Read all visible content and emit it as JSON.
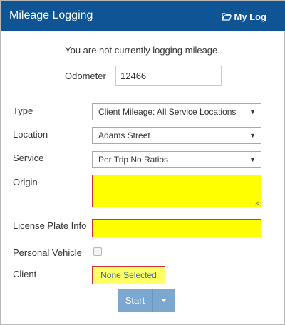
{
  "header": {
    "title": "Mileage Logging",
    "my_log_label": "My Log"
  },
  "status_text": "You are not currently logging mileage.",
  "odometer": {
    "label": "Odometer",
    "value": "12466"
  },
  "type": {
    "label": "Type",
    "value": "Client Mileage: All Service Locations"
  },
  "location": {
    "label": "Location",
    "value": "Adams Street"
  },
  "service": {
    "label": "Service",
    "value": "Per Trip No Ratios"
  },
  "origin": {
    "label": "Origin",
    "value": ""
  },
  "license_plate": {
    "label": "License Plate Info",
    "value": ""
  },
  "personal_vehicle": {
    "label": "Personal Vehicle",
    "checked": false
  },
  "client": {
    "label": "Client",
    "button_label": "None Selected"
  },
  "start": {
    "label": "Start"
  },
  "colors": {
    "header_bg": "#0f5494",
    "required_fill": "#ffff00",
    "required_border": "#cc3333",
    "start_button": "#7ba7d0"
  }
}
